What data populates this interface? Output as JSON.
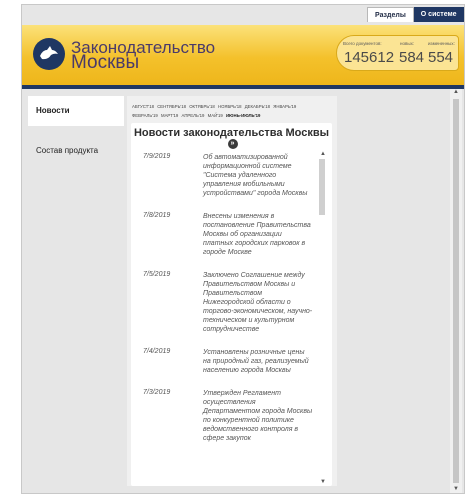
{
  "top_tabs": {
    "sections": "Разделы",
    "about": "О системе"
  },
  "header": {
    "title_line1": "Законодательство",
    "title_line2": "Москвы",
    "stats": {
      "total_label": "Всего документов:",
      "new_label": "новых:",
      "changed_label": "измененных:",
      "total": "145612",
      "new": "584",
      "changed": "554"
    }
  },
  "sidebar": {
    "items": [
      {
        "label": "Новости"
      },
      {
        "label": "Состав продукта"
      }
    ]
  },
  "months": {
    "items": [
      "АВГУСТ'18",
      "СЕНТЯБРЬ'18",
      "ОКТЯБРЬ'18",
      "НОЯБРЬ'18",
      "ДЕКАБРЬ'18",
      "ЯНВАРЬ'19",
      "ФЕВРАЛЬ'19",
      "МАРТ'19",
      "АПРЕЛЬ'19",
      "МАЙ'19",
      "ИЮНЬ-ИЮЛЬ'19"
    ],
    "current": "ИЮНЬ-ИЮЛЬ'19"
  },
  "news": {
    "title": "Новости законодательства Москвы",
    "items": [
      {
        "date": "7/9/2019",
        "text": "Об автоматизированной информационной системе \"Система удаленного управления мобильными устройствами\" города Москвы"
      },
      {
        "date": "7/8/2019",
        "text": "Внесены изменения в постановление Правительства Москвы об организации платных городских парковок в городе Москве"
      },
      {
        "date": "7/5/2019",
        "text": "Заключено Соглашение между Правительством Москвы и Правительством Нижегородской области о торгово-экономическом, научно-техническом и культурном сотрудничестве"
      },
      {
        "date": "7/4/2019",
        "text": "Установлены розничные цены на природный газ, реализуемый населению города Москвы"
      },
      {
        "date": "7/3/2019",
        "text": "Утвержден Регламент осуществления Департаментом города Москвы по конкурентной политике ведомственного контроля в сфере закупок"
      }
    ]
  },
  "colors": {
    "navy": "#1f3763",
    "gold": "#f4c12b"
  }
}
